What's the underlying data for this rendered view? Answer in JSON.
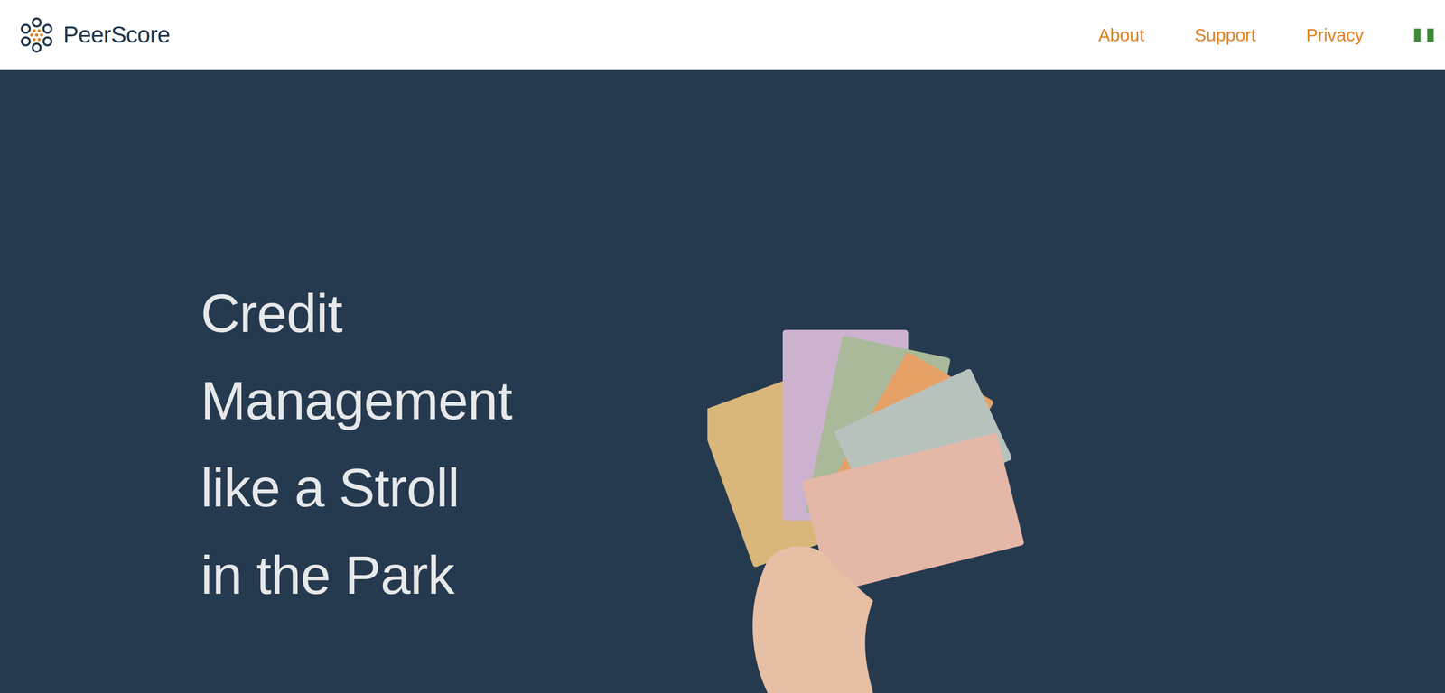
{
  "brand": {
    "name": "PeerScore"
  },
  "nav": [
    {
      "label": "About"
    },
    {
      "label": "Support"
    },
    {
      "label": "Privacy"
    }
  ],
  "hero": {
    "title_lines": [
      "Credit",
      "Management",
      "like a Stroll",
      "in the Park"
    ]
  }
}
